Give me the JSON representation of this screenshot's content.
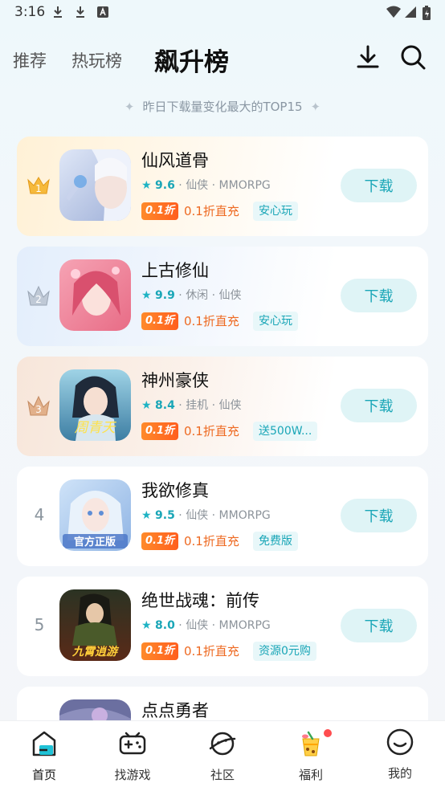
{
  "status": {
    "time": "3:16"
  },
  "header": {
    "tabs": [
      {
        "label": "推荐"
      },
      {
        "label": "热玩榜"
      },
      {
        "label": "飙升榜"
      }
    ]
  },
  "subtitle": "昨日下载量变化最大的TOP15",
  "games": [
    {
      "rank": "1",
      "name": "仙风道骨",
      "score": "9.6",
      "meta": "仙侠 · MMORPG",
      "discount_badge": "0.1折",
      "discount": "0.1折直充",
      "tag": "安心玩",
      "button": "下载"
    },
    {
      "rank": "2",
      "name": "上古修仙",
      "score": "9.9",
      "meta": "休闲 · 仙侠",
      "discount_badge": "0.1折",
      "discount": "0.1折直充",
      "tag": "安心玩",
      "button": "下载"
    },
    {
      "rank": "3",
      "name": "神州豪侠",
      "score": "8.4",
      "meta": "挂机 · 仙侠",
      "discount_badge": "0.1折",
      "discount": "0.1折直充",
      "tag": "送500W...",
      "button": "下载"
    },
    {
      "rank": "4",
      "name": "我欲修真",
      "score": "9.5",
      "meta": "仙侠 · MMORPG",
      "discount_badge": "0.1折",
      "discount": "0.1折直充",
      "tag": "免费版",
      "button": "下载"
    },
    {
      "rank": "5",
      "name": "绝世战魂：前传",
      "score": "8.0",
      "meta": "仙侠 · MMORPG",
      "discount_badge": "0.1折",
      "discount": "0.1折直充",
      "tag": "资源0元购",
      "button": "下载"
    },
    {
      "rank": "",
      "name": "点点勇者"
    }
  ],
  "nav": [
    {
      "label": "首页"
    },
    {
      "label": "找游戏"
    },
    {
      "label": "社区"
    },
    {
      "label": "福利"
    },
    {
      "label": "我的"
    }
  ],
  "icon_texts": {
    "app3": "周青天",
    "app4": "官方正版",
    "app5": "九霄逍游"
  },
  "colors": {
    "accent": "#1aa6b7",
    "discount": "#ee6a22",
    "button_bg": "#dff4f6"
  }
}
